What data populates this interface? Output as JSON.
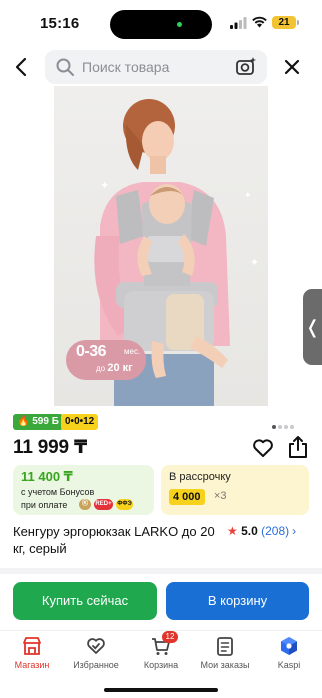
{
  "status_bar": {
    "time": "15:16",
    "battery": "21"
  },
  "search": {
    "placeholder": "Поиск товара"
  },
  "product": {
    "age_badge": {
      "range": "0-36",
      "months": "мес.",
      "upto_prefix": "до",
      "weight": "20 кг"
    },
    "badges": {
      "bonus": "599 Б",
      "installment": "0•0•12"
    },
    "price": "11 999 ₸",
    "bonus_card": {
      "amount": "11 400 ₸",
      "line1": "с учетом Бонусов",
      "line2": "при оплате",
      "pay_methods": [
        "RED+",
        "ФФЭ"
      ]
    },
    "installment_card": {
      "label": "В рассрочку",
      "amount": "4 000",
      "multiplier": "×3"
    },
    "title": "Кенгуру эргорюкзак LARKO до 20 кг, серый",
    "rating": {
      "value": "5.0",
      "count": "(208)"
    }
  },
  "actions": {
    "buy_now": "Купить сейчас",
    "add_to_cart": "В корзину"
  },
  "tabbar": {
    "items": [
      {
        "label": "Магазин",
        "icon": "store-icon",
        "active": true
      },
      {
        "label": "Избранное",
        "icon": "heart-check-icon"
      },
      {
        "label": "Корзина",
        "icon": "cart-icon",
        "badge": "12"
      },
      {
        "label": "Мои заказы",
        "icon": "orders-icon"
      },
      {
        "label": "Kaspi",
        "icon": "kaspi-logo-icon"
      }
    ]
  },
  "colors": {
    "accent_red": "#e0352b",
    "buy_green": "#1fa84e",
    "cart_blue": "#1a6fd4",
    "bonus_green": "#37a51d",
    "installment_yellow": "#f7d21d"
  }
}
